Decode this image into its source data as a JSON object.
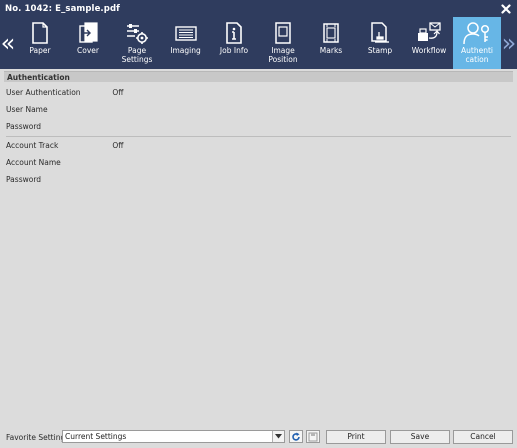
{
  "window": {
    "title": "No. 1042: E_sample.pdf",
    "close_icon": "close-icon"
  },
  "toolbar": {
    "tabs": [
      {
        "label": "Paper",
        "icon": "paper-icon"
      },
      {
        "label": "Cover",
        "icon": "cover-icon"
      },
      {
        "label": "Page Settings",
        "icon": "page-settings-icon"
      },
      {
        "label": "Imaging",
        "icon": "imaging-icon"
      },
      {
        "label": "Job Info",
        "icon": "job-info-icon"
      },
      {
        "label": "Image\nPosition",
        "icon": "image-position-icon"
      },
      {
        "label": "Marks",
        "icon": "marks-icon"
      },
      {
        "label": "Stamp",
        "icon": "stamp-icon"
      },
      {
        "label": "Workflow",
        "icon": "workflow-icon"
      },
      {
        "label": "Authenti\ncation",
        "icon": "authentication-icon",
        "active": true
      }
    ],
    "active_color": "#67b6e6",
    "bar_color": "#2f3c5e"
  },
  "authentication": {
    "section_title": "Authentication",
    "user_authentication": {
      "label": "User Authentication",
      "value": "Off"
    },
    "user_name": {
      "label": "User Name",
      "value": ""
    },
    "password": {
      "label": "Password",
      "value": ""
    },
    "account_track": {
      "label": "Account Track",
      "value": "Off"
    },
    "account_name": {
      "label": "Account Name",
      "value": ""
    },
    "account_password": {
      "label": "Password",
      "value": ""
    }
  },
  "footer": {
    "favorite_label": "Favorite Setting",
    "favorite_value": "Current Settings",
    "print_label": "Print",
    "save_label": "Save",
    "cancel_label": "Cancel"
  }
}
